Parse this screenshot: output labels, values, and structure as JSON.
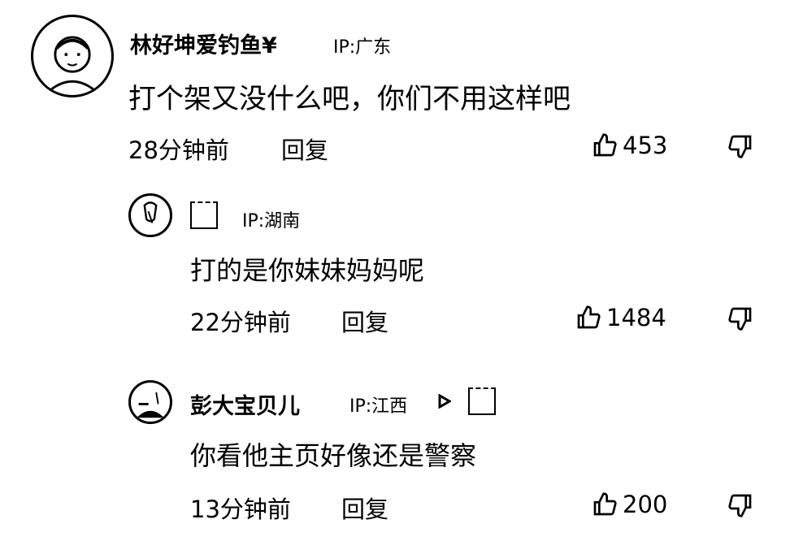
{
  "comments": [
    {
      "name": "林好坤爱钓鱼¥",
      "ip": "IP:广东",
      "content": "打个架又没什么吧，你们不用这样吧",
      "time": "28分钟前",
      "reply": "回复",
      "likes": "453"
    },
    {
      "name": "",
      "ip": "IP:湖南",
      "content": "打的是你妹妹妈妈呢",
      "time": "22分钟前",
      "reply": "回复",
      "likes": "1484"
    },
    {
      "name": "彭大宝贝儿",
      "ip": "IP:江西",
      "content": "你看他主页好像还是警察",
      "time": "13分钟前",
      "reply": "回复",
      "likes": "200"
    }
  ],
  "icons": {
    "like": "thumbs-up-icon",
    "dislike": "thumbs-down-icon",
    "reply_arrow": "play-triangle-icon"
  }
}
